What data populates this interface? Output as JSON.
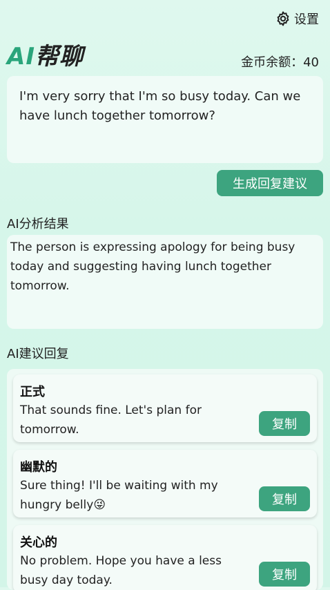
{
  "header": {
    "settings_label": "设置",
    "logo_ai": "AI",
    "logo_name": "帮聊",
    "coins_label": "金币余额：40"
  },
  "input": {
    "message": "I'm very sorry that I'm so busy today. Can we have lunch together tomorrow?"
  },
  "generate_button": "生成回复建议",
  "analysis": {
    "title": "AI分析结果",
    "text": "The person is expressing apology for being busy today and suggesting having lunch together tomorrow."
  },
  "suggestions": {
    "title": "AI建议回复",
    "copy_label": "复制",
    "items": [
      {
        "tone": "正式",
        "text": "That sounds fine. Let's plan for tomorrow."
      },
      {
        "tone": "幽默的",
        "text": "Sure thing! I'll be waiting with my hungry belly😜"
      },
      {
        "tone": "关心的",
        "text": "No problem. Hope you have a less busy day today."
      }
    ]
  },
  "colors": {
    "accent": "#3da47f",
    "logo_green": "#2aa57b",
    "background": "#d6f6ea"
  }
}
